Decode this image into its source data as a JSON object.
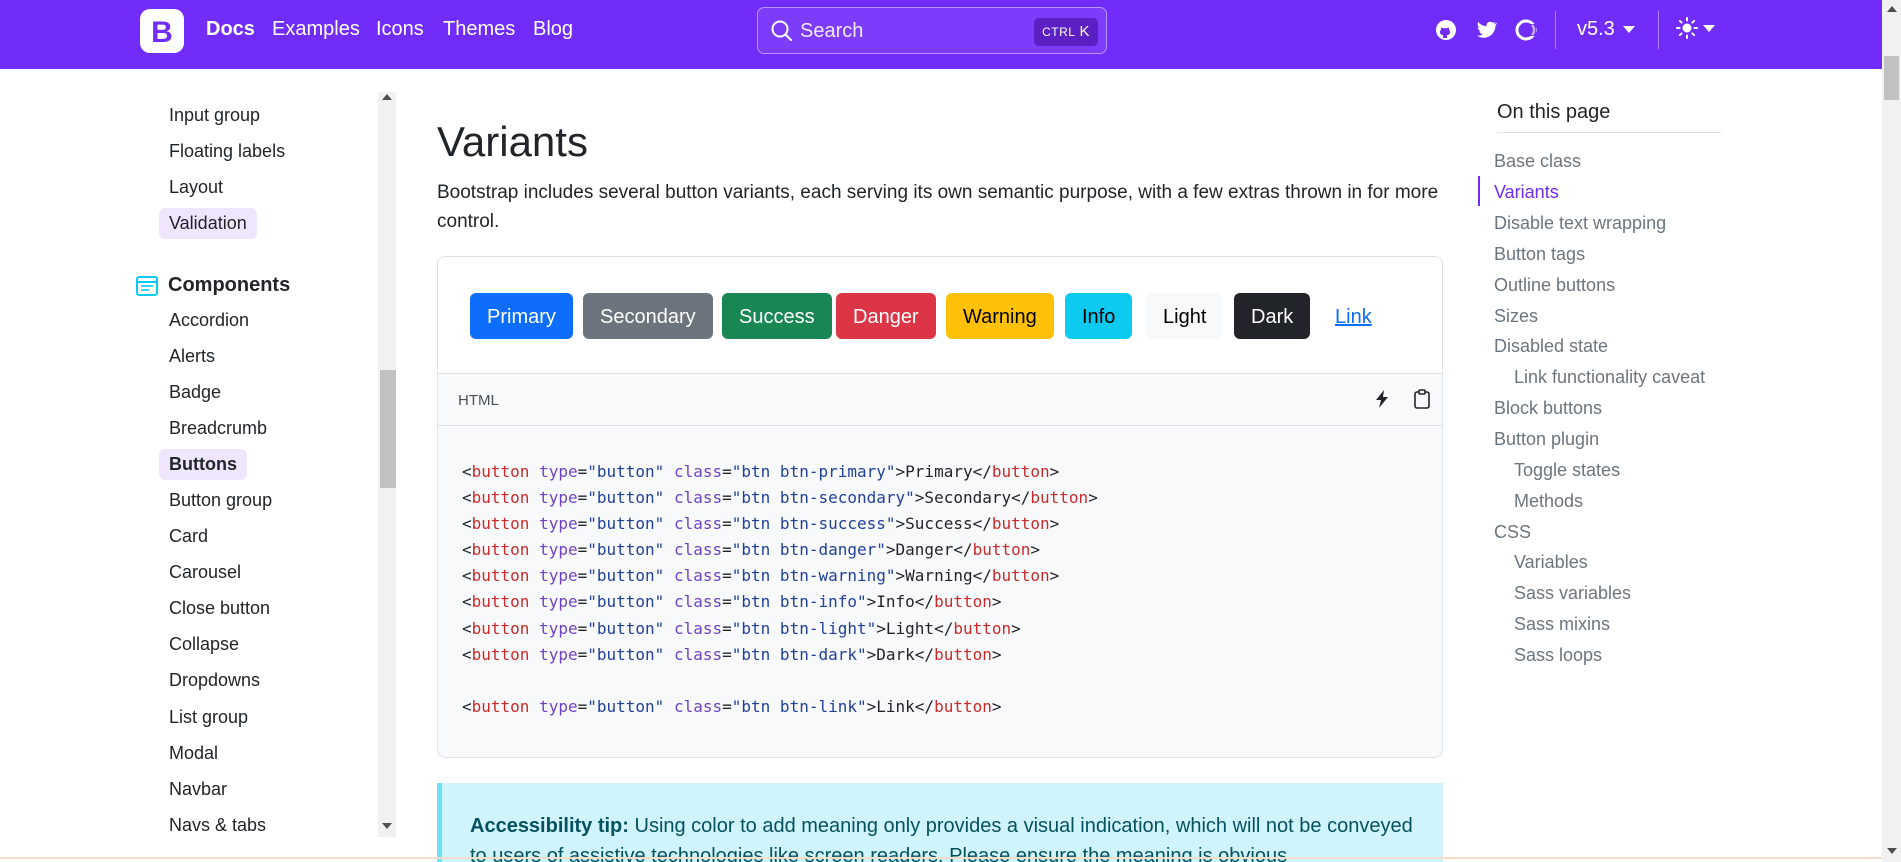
{
  "navbar": {
    "brand_letter": "B",
    "links": [
      "Docs",
      "Examples",
      "Icons",
      "Themes",
      "Blog"
    ],
    "search_placeholder": "Search",
    "search_shortcut_ctrl": "CTRL",
    "search_shortcut_key": "K",
    "version": "v5.3",
    "color": "#712cf9"
  },
  "sidebar": {
    "forms_items": [
      "Input group",
      "Floating labels",
      "Layout",
      "Validation"
    ],
    "components_heading": "Components",
    "components_items": [
      "Accordion",
      "Alerts",
      "Badge",
      "Breadcrumb",
      "Buttons",
      "Button group",
      "Card",
      "Carousel",
      "Close button",
      "Collapse",
      "Dropdowns",
      "List group",
      "Modal",
      "Navbar",
      "Navs & tabs"
    ]
  },
  "main": {
    "title": "Variants",
    "lead": "Bootstrap includes several button variants, each serving its own semantic purpose, with a few extras thrown in for more control.",
    "buttons": [
      {
        "label": "Primary",
        "bg": "#0d6efd",
        "fg": "#ffffff"
      },
      {
        "label": "Secondary",
        "bg": "#6c757d",
        "fg": "#ffffff"
      },
      {
        "label": "Success",
        "bg": "#198754",
        "fg": "#ffffff"
      },
      {
        "label": "Danger",
        "bg": "#dc3545",
        "fg": "#ffffff"
      },
      {
        "label": "Warning",
        "bg": "#ffc107",
        "fg": "#000000"
      },
      {
        "label": "Info",
        "bg": "#0dcaf0",
        "fg": "#000000"
      },
      {
        "label": "Light",
        "bg": "#f8f9fa",
        "fg": "#000000"
      },
      {
        "label": "Dark",
        "bg": "#212529",
        "fg": "#ffffff"
      },
      {
        "label": "Link",
        "bg": "transparent",
        "fg": "#0d6efd"
      }
    ],
    "code_lang": "HTML",
    "code_lines": [
      {
        "cls": "btn btn-primary",
        "text": "Primary"
      },
      {
        "cls": "btn btn-secondary",
        "text": "Secondary"
      },
      {
        "cls": "btn btn-success",
        "text": "Success"
      },
      {
        "cls": "btn btn-danger",
        "text": "Danger"
      },
      {
        "cls": "btn btn-warning",
        "text": "Warning"
      },
      {
        "cls": "btn btn-info",
        "text": "Info"
      },
      {
        "cls": "btn btn-light",
        "text": "Light"
      },
      {
        "cls": "btn btn-dark",
        "text": "Dark"
      },
      {
        "cls": "btn btn-link",
        "text": "Link"
      }
    ],
    "code_tag": "button",
    "code_attr_type": "type",
    "code_attr_type_val": "\"button\"",
    "code_attr_class": "class",
    "callout_strong": "Accessibility tip:",
    "callout_text": " Using color to add meaning only provides a visual indication, which will not be conveyed to users of assistive technologies like screen readers. Please ensure the meaning is obvious"
  },
  "toc": {
    "title": "On this page",
    "items": [
      {
        "label": "Base class",
        "level": 1
      },
      {
        "label": "Variants",
        "level": 1,
        "active": true
      },
      {
        "label": "Disable text wrapping",
        "level": 1
      },
      {
        "label": "Button tags",
        "level": 1
      },
      {
        "label": "Outline buttons",
        "level": 1
      },
      {
        "label": "Sizes",
        "level": 1
      },
      {
        "label": "Disabled state",
        "level": 1
      },
      {
        "label": "Link functionality caveat",
        "level": 2
      },
      {
        "label": "Block buttons",
        "level": 1
      },
      {
        "label": "Button plugin",
        "level": 1
      },
      {
        "label": "Toggle states",
        "level": 2
      },
      {
        "label": "Methods",
        "level": 2
      },
      {
        "label": "CSS",
        "level": 1
      },
      {
        "label": "Variables",
        "level": 2
      },
      {
        "label": "Sass variables",
        "level": 2
      },
      {
        "label": "Sass mixins",
        "level": 2
      },
      {
        "label": "Sass loops",
        "level": 2
      }
    ]
  }
}
